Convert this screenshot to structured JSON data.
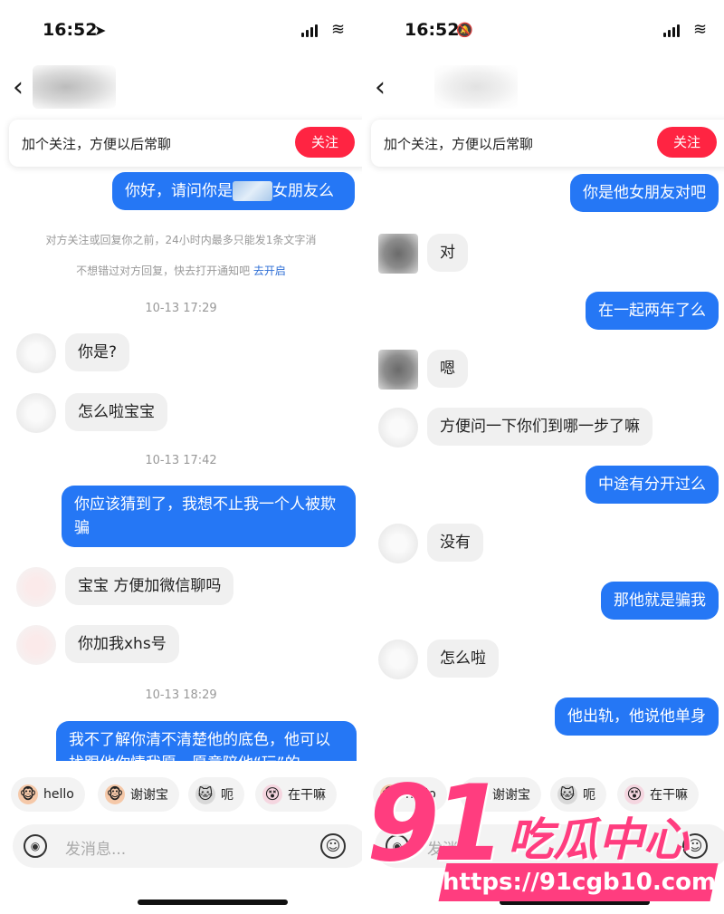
{
  "left": {
    "status": {
      "time": "16:52"
    },
    "follow_bar": {
      "text": "加个关注，方便以后常聊",
      "button": "关注"
    },
    "messages": {
      "m1_a": "你好，请问你是",
      "m1_b": "女朋友么",
      "notice1": "对方关注或回复你之前，24小时内最多只能发1条文字消",
      "notice2": "不想错过对方回复，快去打开通知吧",
      "notice2_link": "去开启",
      "ts1": "10-13 17:29",
      "m2": "你是?",
      "m3": "怎么啦宝宝",
      "ts2": "10-13 17:42",
      "m4": "你应该猜到了，我想不止我一个人被欺骗",
      "m5": "宝宝 方便加微信聊吗",
      "m6": "你加我xhs号",
      "ts3": "10-13 18:29",
      "m7": "我不了解你清不清楚他的底色，他可以找跟他你情我愿，愿意陪他“玩”的"
    },
    "quick_replies": [
      "hello",
      "谢谢宝",
      "呃",
      "在干嘛"
    ],
    "input": {
      "placeholder": "发消息..."
    }
  },
  "right": {
    "status": {
      "time": "16:52"
    },
    "follow_bar": {
      "text": "加个关注，方便以后常聊",
      "button": "关注"
    },
    "messages": {
      "r1": "你是他女朋友对吧",
      "r2": "对",
      "r3": "在一起两年了么",
      "r4": "嗯",
      "r5": "方便问一下你们到哪一步了嘛",
      "r6": "中途有分开过么",
      "r7": "没有",
      "r8": "那他就是骗我",
      "r9": "怎么啦",
      "r10": "他出轨，他说他单身"
    },
    "quick_replies": [
      "hello",
      "谢谢宝",
      "呃",
      "在干嘛"
    ],
    "input": {
      "placeholder": "发消息..."
    }
  },
  "watermark": {
    "number": "91",
    "brand": "吃瓜中心",
    "url": "https://91cgb10.com"
  },
  "colors": {
    "accent_blue": "#2577f5",
    "follow_red": "#ff2442",
    "watermark_pink": "#ff3d7f",
    "incoming_gray": "#f0f0f0"
  },
  "icons": [
    "location-arrow-icon",
    "mute-bell-icon",
    "signal-icon",
    "wifi-icon",
    "back-chevron-icon",
    "voice-icon",
    "smiley-icon"
  ]
}
